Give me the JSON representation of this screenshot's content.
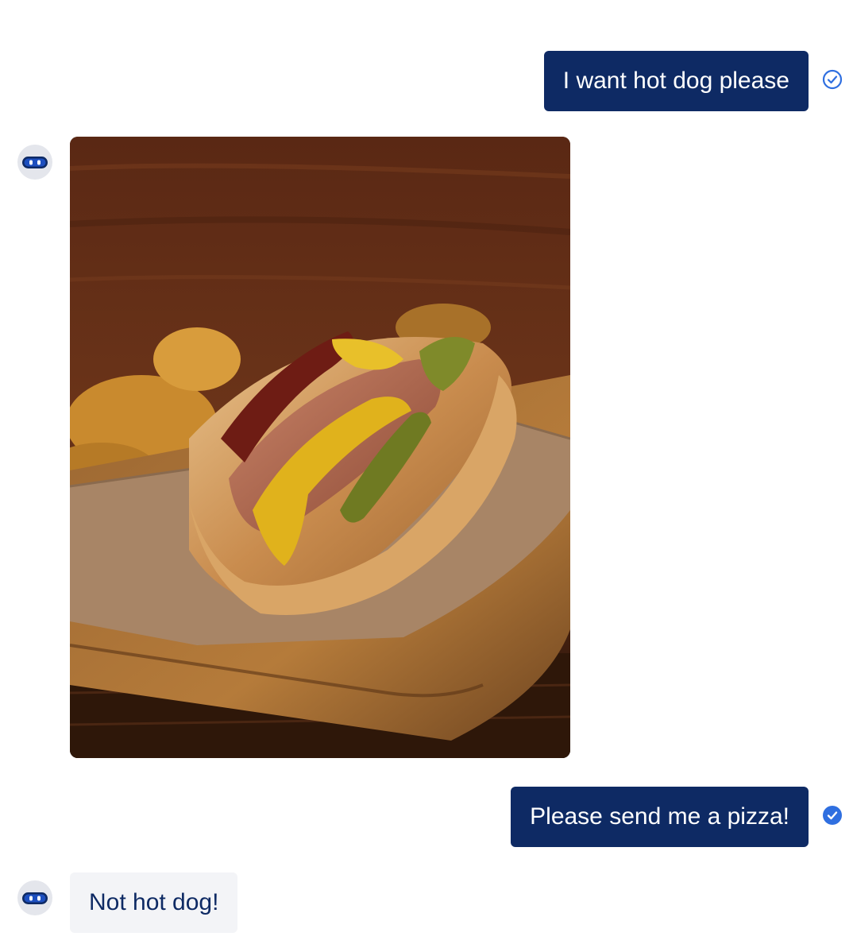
{
  "conversation": {
    "messages": [
      {
        "sender": "user",
        "text": "I want hot dog please",
        "status": "delivered"
      },
      {
        "sender": "bot",
        "type": "image",
        "image": "hot-dog-photo"
      },
      {
        "sender": "user",
        "text": "Please send me a pizza!",
        "status": "read"
      },
      {
        "sender": "bot",
        "text": "Not hot dog!"
      }
    ]
  },
  "colors": {
    "user_bubble": "#0e2a64",
    "bot_bubble": "#f3f4f7",
    "bot_text": "#0e2a64",
    "status_icon": "#2f6fe0",
    "avatar_bg": "#e4e6ec"
  },
  "icons": {
    "status_delivered": "check-circle-outline-icon",
    "status_read": "check-circle-filled-icon",
    "bot_avatar": "robot-icon"
  }
}
